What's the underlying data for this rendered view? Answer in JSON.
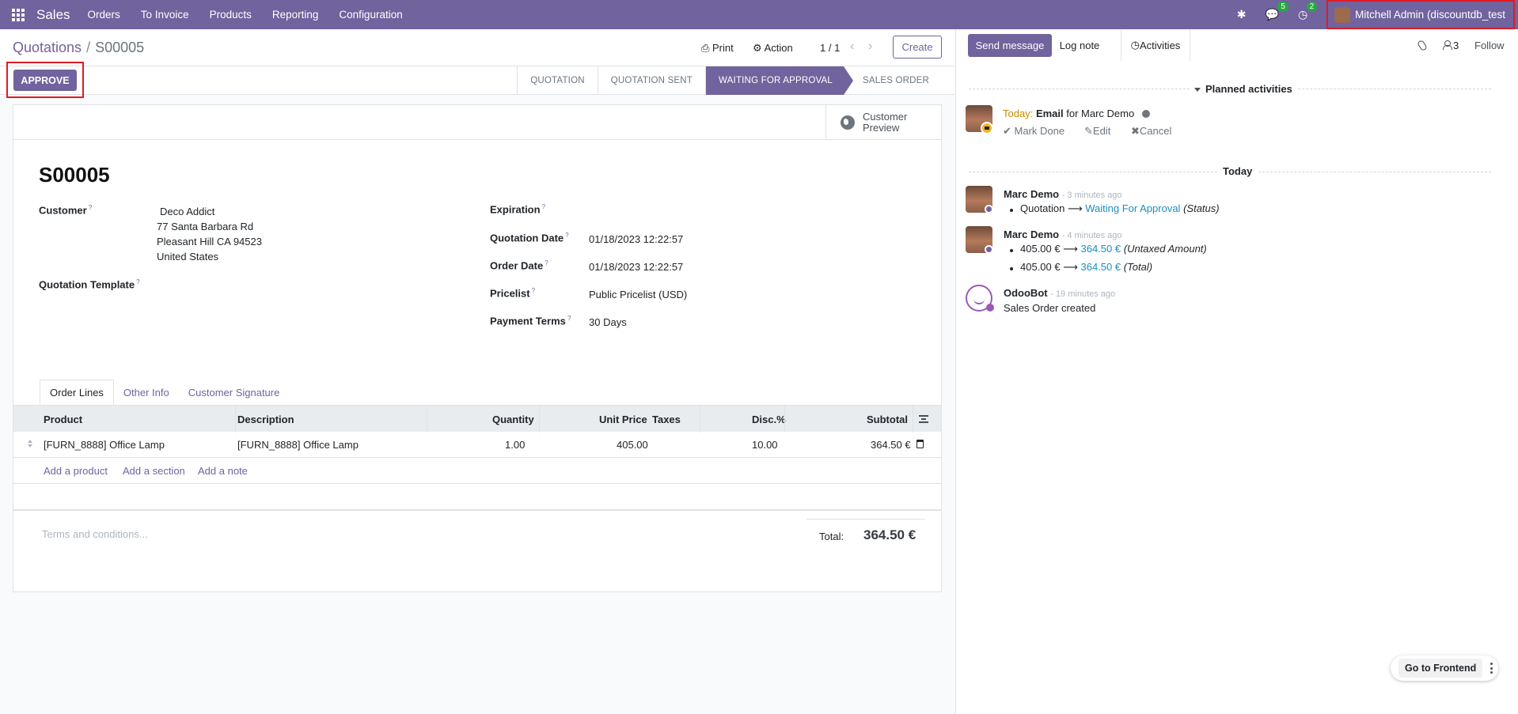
{
  "topbar": {
    "app_name": "Sales",
    "menu": [
      "Orders",
      "To Invoice",
      "Products",
      "Reporting",
      "Configuration"
    ],
    "messages_count": "5",
    "activities_count": "2",
    "user_name": "Mitchell Admin (discountdb_test"
  },
  "control": {
    "breadcrumb_parent": "Quotations",
    "breadcrumb_sep": "/",
    "breadcrumb_current": "S00005",
    "print_label": "Print",
    "action_label": "Action",
    "pager": "1 / 1",
    "create_label": "Create"
  },
  "status": {
    "approve_label": "APPROVE",
    "stages": [
      "QUOTATION",
      "QUOTATION SENT",
      "WAITING FOR APPROVAL",
      "SALES ORDER"
    ],
    "active_stage": "WAITING FOR APPROVAL"
  },
  "form": {
    "preview_label_1": "Customer",
    "preview_label_2": "Preview",
    "title": "S00005",
    "customer_label": "Customer",
    "customer_name": "Deco Addict",
    "address_1": "77 Santa Barbara Rd",
    "address_2": "Pleasant Hill CA 94523",
    "address_3": "United States",
    "template_label": "Quotation Template",
    "expiration_label": "Expiration",
    "quotation_date_label": "Quotation Date",
    "quotation_date": "01/18/2023 12:22:57",
    "order_date_label": "Order Date",
    "order_date": "01/18/2023 12:22:57",
    "pricelist_label": "Pricelist",
    "pricelist": "Public Pricelist (USD)",
    "payment_terms_label": "Payment Terms",
    "payment_terms": "30 Days",
    "help_mark": "?"
  },
  "tabs": [
    "Order Lines",
    "Other Info",
    "Customer Signature"
  ],
  "table": {
    "headers": {
      "product": "Product",
      "description": "Description",
      "quantity": "Quantity",
      "unit_price": "Unit Price",
      "taxes": "Taxes",
      "discount": "Disc.%",
      "subtotal": "Subtotal"
    },
    "rows": [
      {
        "product": "[FURN_8888] Office Lamp",
        "description": "[FURN_8888] Office Lamp",
        "quantity": "1.00",
        "unit_price": "405.00",
        "taxes": "",
        "discount": "10.00",
        "subtotal": "364.50 €"
      }
    ],
    "add_product": "Add a product",
    "add_section": "Add a section",
    "add_note": "Add a note"
  },
  "footer": {
    "terms_placeholder": "Terms and conditions...",
    "total_label": "Total:",
    "total_value": "364.50 €"
  },
  "chatter": {
    "send_message": "Send message",
    "log_note": "Log note",
    "activities": "Activities",
    "followers_count": "3",
    "follow": "Follow",
    "planned_activities": "Planned activities",
    "activity_today": "Today:",
    "activity_type": "Email",
    "activity_for": "for Marc Demo",
    "mark_done": "Mark Done",
    "edit": "Edit",
    "cancel": "Cancel",
    "day_label": "Today",
    "messages": [
      {
        "author": "Marc Demo",
        "time": "- 3 minutes ago",
        "lines": [
          {
            "field": "Quotation",
            "arrow": "⟶",
            "new": "Waiting For Approval",
            "label": "(Status)"
          }
        ]
      },
      {
        "author": "Marc Demo",
        "time": "- 4 minutes ago",
        "lines": [
          {
            "old": "405.00 €",
            "arrow": "⟶",
            "new": "364.50 €",
            "label": "(Untaxed Amount)"
          },
          {
            "old": "405.00 €",
            "arrow": "⟶",
            "new": "364.50 €",
            "label": "(Total)"
          }
        ]
      },
      {
        "author": "OdooBot",
        "time": "- 19 minutes ago",
        "body": "Sales Order created"
      }
    ]
  },
  "floating": {
    "go_to_frontend": "Go to Frontend"
  },
  "colors": {
    "brand": "#71639e",
    "highlight_box": "#e01b24",
    "link": "#1a8fbd",
    "badge": "#28a745"
  }
}
